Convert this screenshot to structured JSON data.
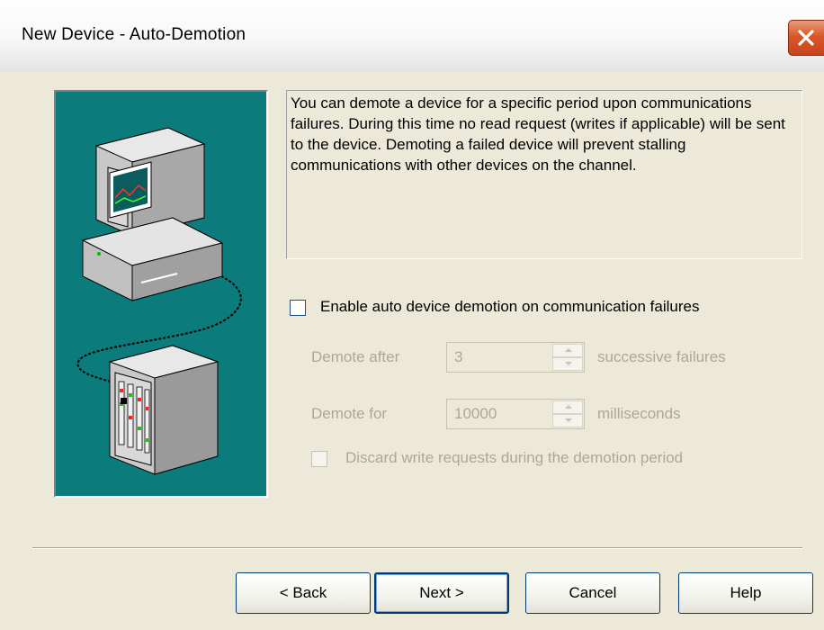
{
  "window": {
    "title": "New Device - Auto-Demotion"
  },
  "description": "You can demote a device for a specific period upon communications failures. During this time no read request (writes if applicable) will be sent to the device. Demoting a failed device will prevent stalling communications with other devices on the channel.",
  "enable_demotion": {
    "label": "Enable auto device demotion on communication failures",
    "checked": false
  },
  "demote_after": {
    "label": "Demote after",
    "value": "3",
    "unit": "successive failures"
  },
  "demote_for": {
    "label": "Demote for",
    "value": "10000",
    "unit": "milliseconds"
  },
  "discard_writes": {
    "label": "Discard write requests during the demotion period",
    "checked": false
  },
  "buttons": {
    "back": "< Back",
    "next": "Next >",
    "cancel": "Cancel",
    "help": "Help"
  },
  "icons": {
    "close": "close-icon",
    "illustration": "computer-device-illustration"
  },
  "colors": {
    "panel_teal": "#0b7b7b",
    "close_red": "#d9582a",
    "dialog_bg": "#ece9d8"
  }
}
